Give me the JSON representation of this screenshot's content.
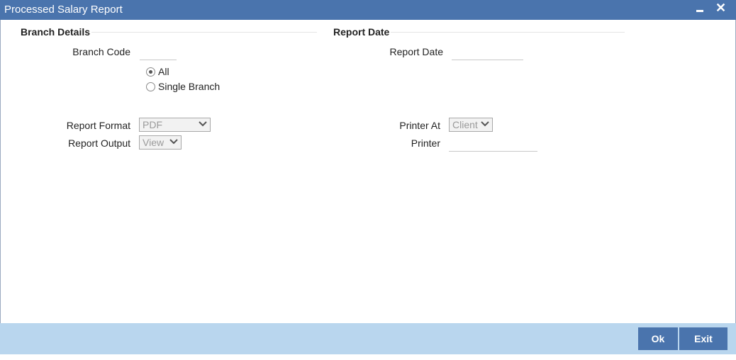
{
  "window": {
    "title": "Processed Salary Report"
  },
  "sections": {
    "branch_details": "Branch Details",
    "report_date": "Report Date"
  },
  "fields": {
    "branch_code_label": "Branch Code",
    "branch_code_value": "",
    "report_date_label": "Report Date",
    "report_date_value": "",
    "report_format_label": "Report Format",
    "report_format_value": "PDF",
    "report_output_label": "Report Output",
    "report_output_value": "View",
    "printer_at_label": "Printer At",
    "printer_at_value": "Client",
    "printer_label": "Printer",
    "printer_value": ""
  },
  "branch_options": [
    {
      "label": "All",
      "checked": true
    },
    {
      "label": "Single Branch",
      "checked": false
    }
  ],
  "buttons": {
    "ok": "Ok",
    "exit": "Exit"
  },
  "colors": {
    "titlebar": "#4a74ad",
    "footer": "#b9d6ee",
    "button": "#4a74ad"
  }
}
